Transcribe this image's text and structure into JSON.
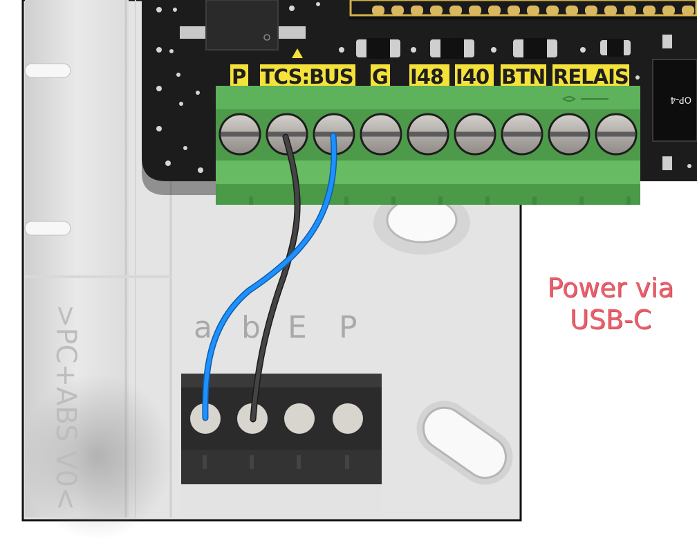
{
  "board": {
    "terminal_labels": [
      "P",
      "TCS:BUS",
      "G",
      "I48",
      "I40",
      "BTN",
      "RELAIS"
    ],
    "chip_label": "OP-4"
  },
  "base": {
    "terminal_labels": [
      "a",
      "b",
      "E",
      "P"
    ],
    "material_text": ">PC+ABS V0<"
  },
  "note": {
    "line1": "Power via",
    "line2": "USB-C"
  },
  "colors": {
    "pcb": "#1c1c1c",
    "terminal_block": "#58a856",
    "label_background": "#f4e23a",
    "wire_a": "#1e90ff",
    "wire_b": "#3c3c3c",
    "note_text": "#e8606b",
    "base_plate": "#e6e6e6",
    "base_terminal": "#2b2b2b"
  },
  "icons": {
    "direction_marker": "triangle-up-icon"
  }
}
